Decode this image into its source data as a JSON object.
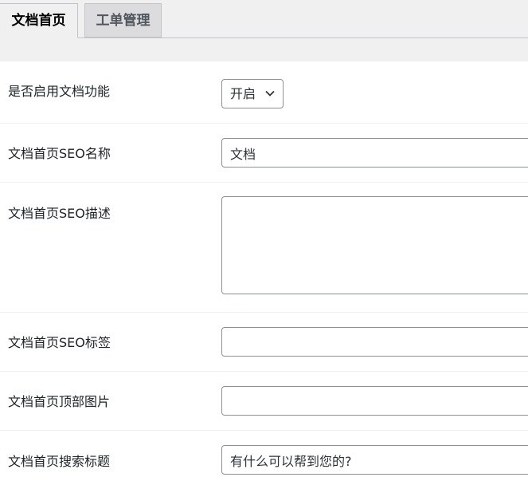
{
  "tabs": [
    {
      "label": "文档首页",
      "active": true
    },
    {
      "label": "工单管理",
      "active": false
    }
  ],
  "form": {
    "enable": {
      "label": "是否启用文档功能",
      "value": "开启"
    },
    "seo_name": {
      "label": "文档首页SEO名称",
      "value": "文档"
    },
    "seo_desc": {
      "label": "文档首页SEO描述",
      "value": ""
    },
    "seo_tags": {
      "label": "文档首页SEO标签",
      "value": ""
    },
    "top_image": {
      "label": "文档首页顶部图片",
      "value": ""
    },
    "search_title": {
      "label": "文档首页搜索标题",
      "value": "有什么可以帮到您的?"
    }
  },
  "icons": {
    "select_arrow": "chevron-down-icon"
  },
  "colors": {
    "tab_bar_bg": "#f0f0f1",
    "inactive_tab_bg": "#dcdcde",
    "border": "#8c8f94"
  }
}
